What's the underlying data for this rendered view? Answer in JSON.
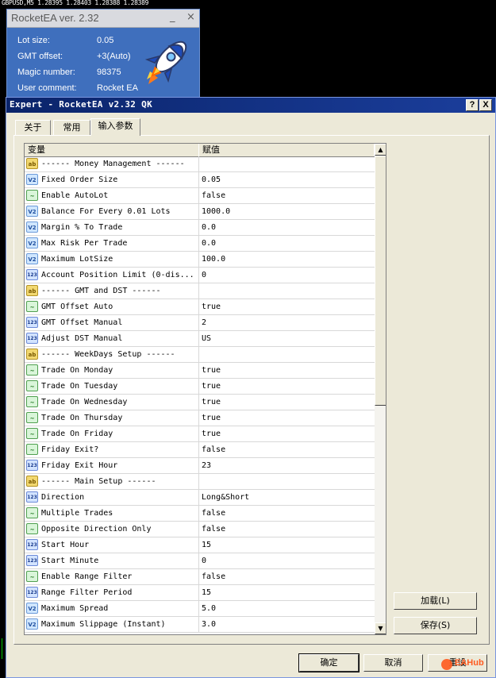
{
  "chart": {
    "header": "GBPUSD,M5  1.28395 1.28403 1.28388 1.28389"
  },
  "ea_panel": {
    "title": "RocketEA ver. 2.32",
    "min_glyph": "_",
    "close_glyph": "×",
    "rows": [
      {
        "key": "Lot size:",
        "value": "0.05"
      },
      {
        "key": "GMT offset:",
        "value": "+3(Auto)"
      },
      {
        "key": "Magic number:",
        "value": "98375"
      },
      {
        "key": "User comment:",
        "value": "Rocket EA"
      }
    ]
  },
  "dialog": {
    "title": "Expert - RocketEA v2.32 QK",
    "help_glyph": "?",
    "close_glyph": "X",
    "tabs": [
      {
        "label": "关于"
      },
      {
        "label": "常用"
      },
      {
        "label": "输入参数"
      }
    ],
    "grid": {
      "col_variable": "变量",
      "col_value": "赋值",
      "rows": [
        {
          "icon": "ab",
          "name": "------ Money Management ------",
          "value": ""
        },
        {
          "icon": "v2",
          "name": "Fixed Order Size",
          "value": "0.05"
        },
        {
          "icon": "bool",
          "name": "Enable AutoLot",
          "value": "false"
        },
        {
          "icon": "v2",
          "name": "Balance For Every 0.01 Lots",
          "value": "1000.0"
        },
        {
          "icon": "v2",
          "name": "Margin % To Trade",
          "value": "0.0"
        },
        {
          "icon": "v2",
          "name": "Max Risk Per Trade",
          "value": "0.0"
        },
        {
          "icon": "v2",
          "name": "Maximum LotSize",
          "value": "100.0"
        },
        {
          "icon": "123",
          "name": "Account Position Limit (0-dis...",
          "value": "0"
        },
        {
          "icon": "ab",
          "name": "------ GMT and DST ------",
          "value": ""
        },
        {
          "icon": "bool",
          "name": "GMT Offset Auto",
          "value": "true"
        },
        {
          "icon": "123",
          "name": "GMT Offset Manual",
          "value": "2"
        },
        {
          "icon": "123",
          "name": "Adjust DST Manual",
          "value": "US"
        },
        {
          "icon": "ab",
          "name": "------ WeekDays Setup ------",
          "value": ""
        },
        {
          "icon": "bool",
          "name": "Trade On Monday",
          "value": "true"
        },
        {
          "icon": "bool",
          "name": "Trade On Tuesday",
          "value": "true"
        },
        {
          "icon": "bool",
          "name": "Trade On Wednesday",
          "value": "true"
        },
        {
          "icon": "bool",
          "name": "Trade On Thursday",
          "value": "true"
        },
        {
          "icon": "bool",
          "name": "Trade On Friday",
          "value": "true"
        },
        {
          "icon": "bool",
          "name": "Friday Exit?",
          "value": "false"
        },
        {
          "icon": "123",
          "name": "Friday Exit Hour",
          "value": "23"
        },
        {
          "icon": "ab",
          "name": "------ Main Setup ------",
          "value": ""
        },
        {
          "icon": "123",
          "name": "Direction",
          "value": "Long&Short"
        },
        {
          "icon": "bool",
          "name": "Multiple Trades",
          "value": "false"
        },
        {
          "icon": "bool",
          "name": "Opposite Direction Only",
          "value": "false"
        },
        {
          "icon": "123",
          "name": "Start Hour",
          "value": "15"
        },
        {
          "icon": "123",
          "name": "Start Minute",
          "value": "0"
        },
        {
          "icon": "bool",
          "name": "Enable Range Filter",
          "value": "false"
        },
        {
          "icon": "123",
          "name": "Range Filter Period",
          "value": "15"
        },
        {
          "icon": "v2",
          "name": "Maximum Spread",
          "value": "5.0"
        },
        {
          "icon": "v2",
          "name": "Maximum Slippage (Instant)",
          "value": "3.0"
        }
      ]
    },
    "buttons": {
      "load": "加载(L)",
      "save": "保存(S)",
      "ok": "确定",
      "cancel": "取消",
      "reset": "重设"
    }
  },
  "watermark": "EAHub",
  "icon_labels": {
    "ab": "ab",
    "v2": "V2",
    "123": "123",
    "bool": "~"
  }
}
